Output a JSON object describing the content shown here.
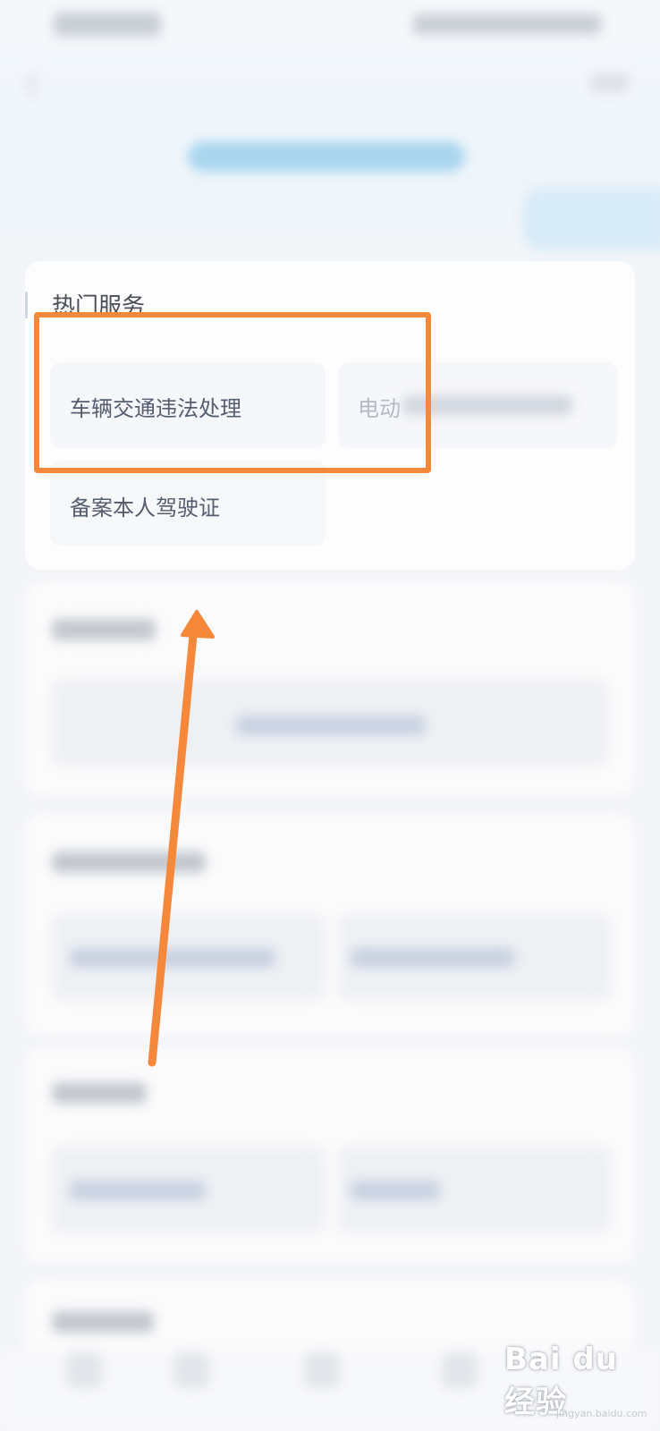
{
  "hot_services": {
    "title": "热门服务",
    "items": [
      {
        "label": "车辆交通违法处理"
      },
      {
        "label": "电动"
      },
      {
        "label": "备案本人驾驶证"
      }
    ]
  },
  "annotation": {
    "highlight_color": "#f5883a",
    "arrow_color": "#f5883a"
  },
  "watermark": {
    "brand": "Bai du 经验",
    "url": "jingyan.baidu.com"
  }
}
